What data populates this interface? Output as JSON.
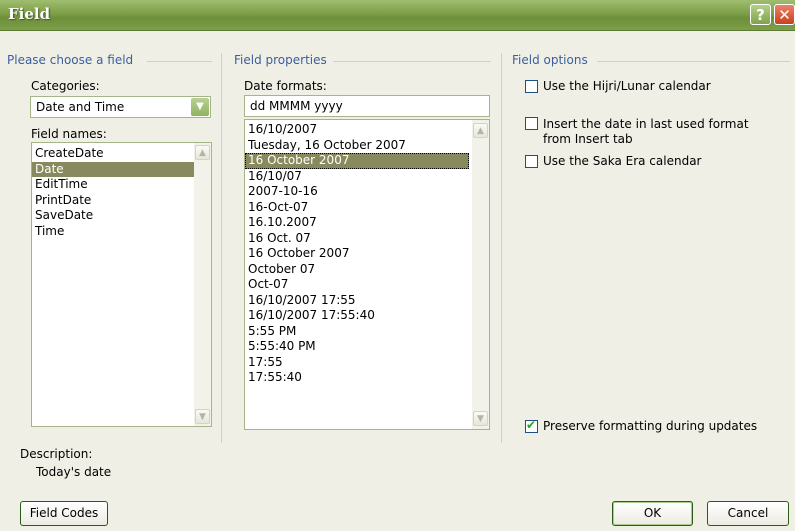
{
  "title": "Field",
  "titlebar": {
    "help": "?",
    "close": "✕"
  },
  "left": {
    "header": "Please choose a field",
    "categories_label": "Categories:",
    "categories_value": "Date and Time",
    "field_names_label": "Field names:",
    "field_names": [
      "CreateDate",
      "Date",
      "EditTime",
      "PrintDate",
      "SaveDate",
      "Time"
    ],
    "selected_field": "Date",
    "description_label": "Description:",
    "description_value": "Today's date",
    "field_codes_button": "Field Codes"
  },
  "middle": {
    "header": "Field properties",
    "date_formats_label": "Date formats:",
    "date_format_value": "dd MMMM yyyy",
    "formats": [
      "16/10/2007",
      "Tuesday, 16 October 2007",
      "16 October 2007",
      "16/10/07",
      "2007-10-16",
      "16-Oct-07",
      "16.10.2007",
      "16 Oct. 07",
      "16 October 2007",
      "October 07",
      "Oct-07",
      "16/10/2007 17:55",
      "16/10/2007 17:55:40",
      "5:55 PM",
      "5:55:40 PM",
      "17:55",
      "17:55:40"
    ],
    "selected_format": "16 October 2007"
  },
  "right": {
    "header": "Field options",
    "options": [
      {
        "label": "Use the Hijri/Lunar calendar",
        "checked": false
      },
      {
        "label": "Insert the date in last used format from Insert tab",
        "checked": false
      },
      {
        "label": "Use the Saka Era calendar",
        "checked": false
      }
    ],
    "preserve_label": "Preserve formatting during updates",
    "preserve_checked": true
  },
  "buttons": {
    "ok": "OK",
    "cancel": "Cancel"
  }
}
